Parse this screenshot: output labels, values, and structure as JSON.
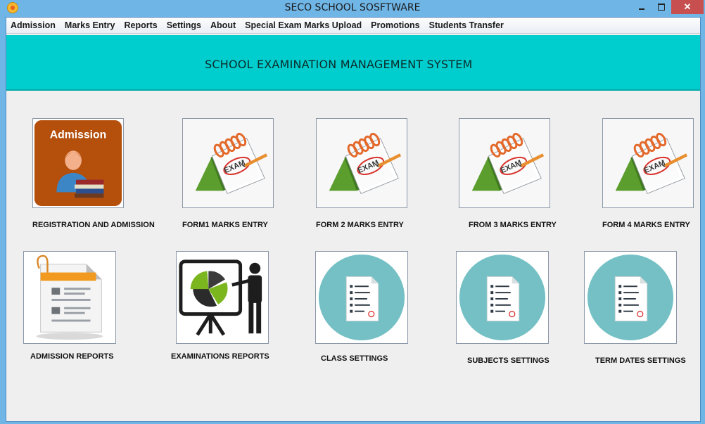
{
  "window": {
    "title": "SECO SCHOOL SOSFTWARE",
    "close_glyph": "✕"
  },
  "menu": [
    "Admission",
    "Marks Entry",
    "Reports",
    "Settings",
    "About",
    "Special Exam Marks Upload",
    "Promotions",
    "Students Transfer"
  ],
  "banner": {
    "title": "SCHOOL EXAMINATION MANAGEMENT SYSTEM",
    "color": "#00cdcd"
  },
  "tiles": {
    "admission": {
      "label": "REGISTRATION AND ADMISSION",
      "icon_text": "Admission",
      "icon": "admission-person-books-icon"
    },
    "form1": {
      "label": "FORM1 MARKS ENTRY",
      "icon_text": "EXAM",
      "icon": "exam-notepad-icon"
    },
    "form2": {
      "label": "FORM 2 MARKS ENTRY",
      "icon_text": "EXAM",
      "icon": "exam-notepad-icon"
    },
    "form3": {
      "label": "FROM 3 MARKS ENTRY",
      "icon_text": "EXAM",
      "icon": "exam-notepad-icon"
    },
    "form4": {
      "label": "FORM 4 MARKS ENTRY",
      "icon_text": "EXAM",
      "icon": "exam-notepad-icon"
    },
    "admission_reports": {
      "label": "ADMISSION REPORTS",
      "icon": "clipboard-document-icon"
    },
    "exam_reports": {
      "label": "EXAMINATIONS REPORTS",
      "icon": "presentation-pie-chart-icon"
    },
    "class_settings": {
      "label": "CLASS SETTINGS",
      "icon": "checklist-document-icon"
    },
    "subjects_settings": {
      "label": "SUBJECTS SETTINGS",
      "icon": "checklist-document-icon"
    },
    "term_dates_settings": {
      "label": "TERM DATES  SETTINGS",
      "icon": "checklist-document-icon"
    }
  }
}
